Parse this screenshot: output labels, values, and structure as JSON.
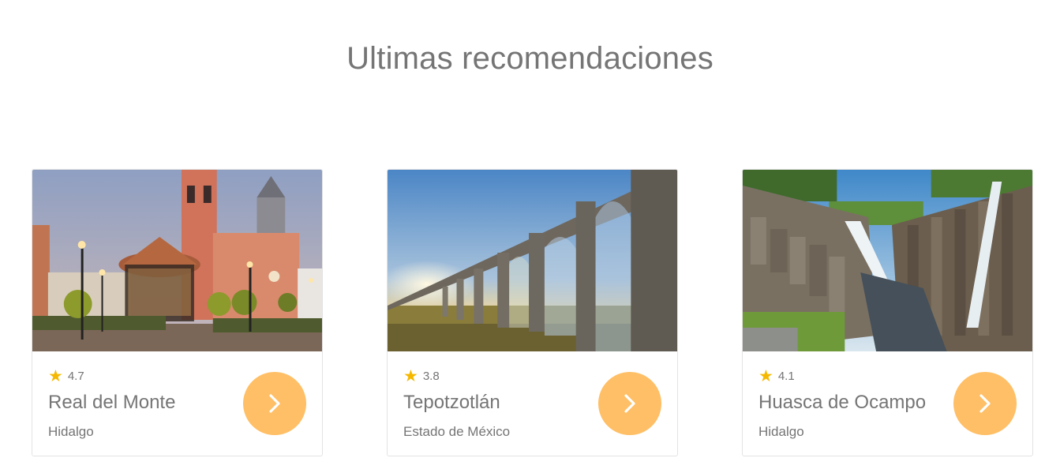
{
  "section": {
    "title": "Ultimas recomendaciones"
  },
  "cards": [
    {
      "rating": "4.7",
      "name": "Real del Monte",
      "state": "Hidalgo",
      "image": "town-square-church-photo"
    },
    {
      "rating": "3.8",
      "name": "Tepotzotlán",
      "state": "Estado de México",
      "image": "aqueduct-sunset-photo"
    },
    {
      "rating": "4.1",
      "name": "Huasca de Ocampo",
      "state": "Hidalgo",
      "image": "basalt-prisms-waterfall-photo"
    }
  ],
  "icons": {
    "rating": "star-icon",
    "button": "chevron-right-icon"
  },
  "colors": {
    "accent": "#ffbf66",
    "star": "#f5b800",
    "text": "#757575"
  }
}
